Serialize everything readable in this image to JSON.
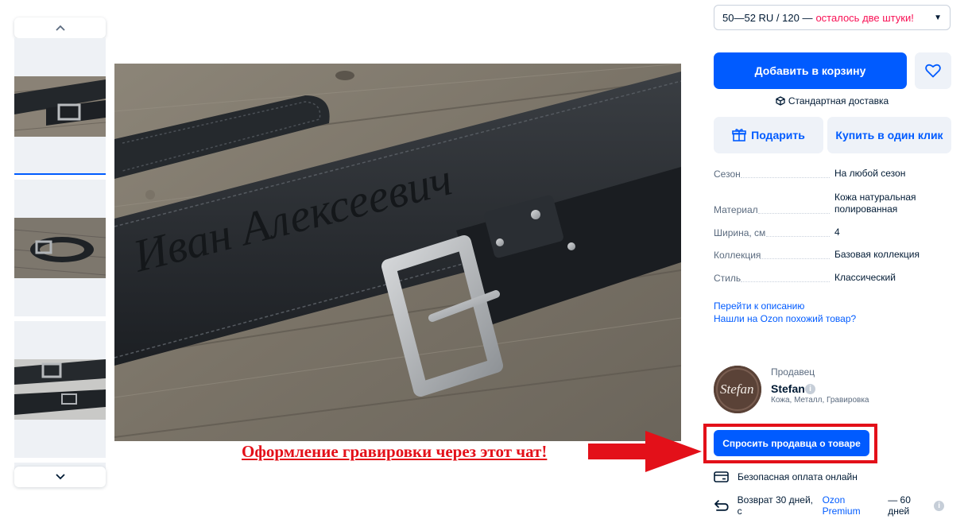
{
  "gallery": {
    "up_arrow": "chevron-up-icon",
    "down_arrow": "chevron-down-icon"
  },
  "main_image": {
    "engraving_text": "Иван Алексеевич"
  },
  "size_select": {
    "value": "50—52 RU / 120 — ",
    "stock_warning": "осталось две штуки!"
  },
  "actions": {
    "add_to_cart": "Добавить в корзину",
    "delivery": "Стандартная доставка",
    "gift": "Подарить",
    "buy_one_click": "Купить в один клик"
  },
  "specs": [
    {
      "key": "Сезон",
      "value": "На любой сезон"
    },
    {
      "key": "Материал",
      "value": "Кожа натуральная полированная"
    },
    {
      "key": "Ширина, см",
      "value": "4"
    },
    {
      "key": "Коллекция",
      "value": "Базовая коллекция"
    },
    {
      "key": "Стиль",
      "value": "Классический"
    }
  ],
  "links": {
    "go_to_description": "Перейти к описанию",
    "found_similar": "Нашли на Ozon похожий товар?"
  },
  "seller": {
    "label": "Продавец",
    "name": "Stefan",
    "categories": "Кожа, Металл, Гравировка",
    "logo_text": "Stefan"
  },
  "ask_seller": "Спросить продавца о товаре",
  "annotation": "Оформление гравировки через этот чат!",
  "payment": "Безопасная оплата онлайн",
  "return": {
    "prefix": "Возврат 30 дней, с",
    "premium": "Ozon Premium",
    "suffix": "— 60 дней"
  },
  "colors": {
    "accent": "#005bff",
    "warning": "#f91155",
    "annotation_red": "#e31019"
  }
}
